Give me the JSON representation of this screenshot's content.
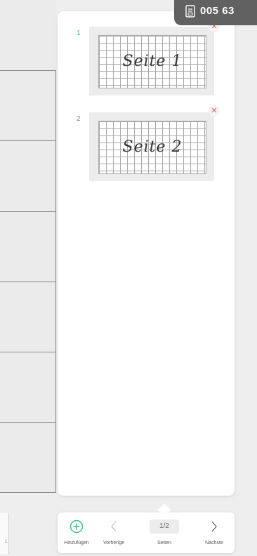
{
  "badge": {
    "code": "005 63",
    "icon": "document-icon"
  },
  "pages": [
    {
      "number": "1",
      "label": "Seite 1",
      "active": true
    },
    {
      "number": "2",
      "label": "Seite 2",
      "active": false
    }
  ],
  "toolbar": {
    "add_label": "Hinzufügen",
    "prev_label": "Vorherige",
    "page_indicator": "1/2",
    "pages_label": "Seiten",
    "next_label": "Nächste"
  },
  "side": {
    "hint": "1"
  },
  "colors": {
    "accent": "#3bbf8a",
    "remove": "#e26060",
    "badge_bg": "#616161"
  }
}
